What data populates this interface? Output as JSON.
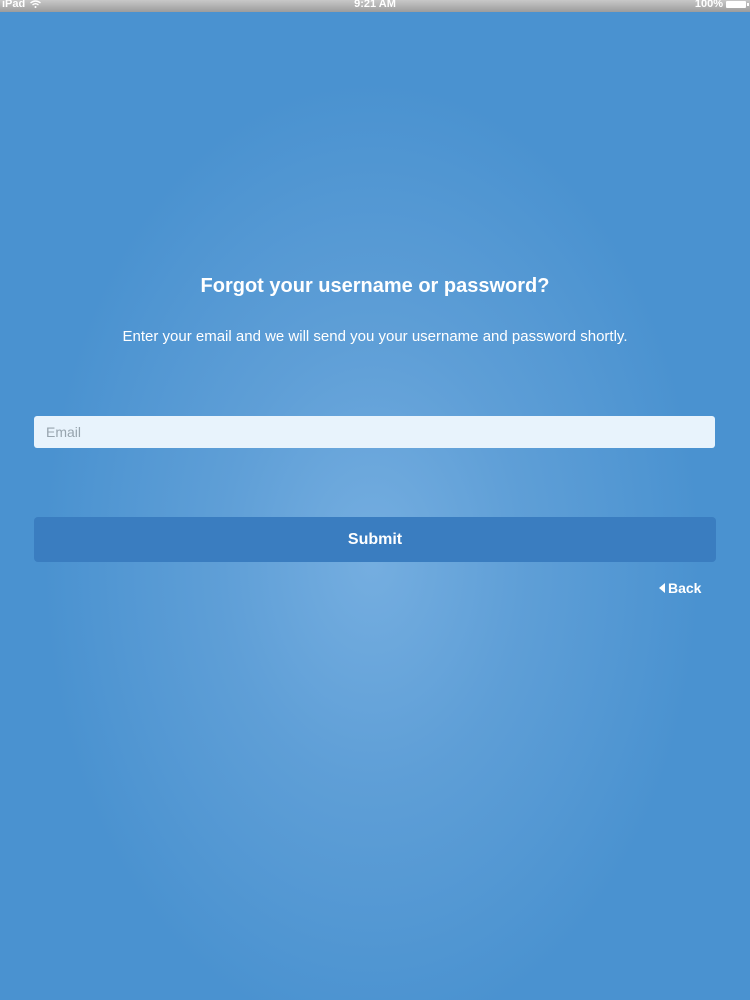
{
  "status_bar": {
    "device": "iPad",
    "wifi_icon": "wifi-icon",
    "time": "9:21 AM",
    "battery_level": "100%",
    "battery_icon": "battery-icon"
  },
  "form": {
    "title": "Forgot your username or password?",
    "instructions": "Enter your email and we will send you your username and password shortly.",
    "email": {
      "value": "",
      "placeholder": "Email"
    },
    "submit_label": "Submit",
    "back_label": "Back",
    "back_icon": "chevron-left-icon"
  },
  "colors": {
    "background": "#4a92d0",
    "background_center": "#75aee0",
    "button": "#3a7dc0",
    "input_background": "#e8f3fc",
    "text": "#ffffff"
  }
}
